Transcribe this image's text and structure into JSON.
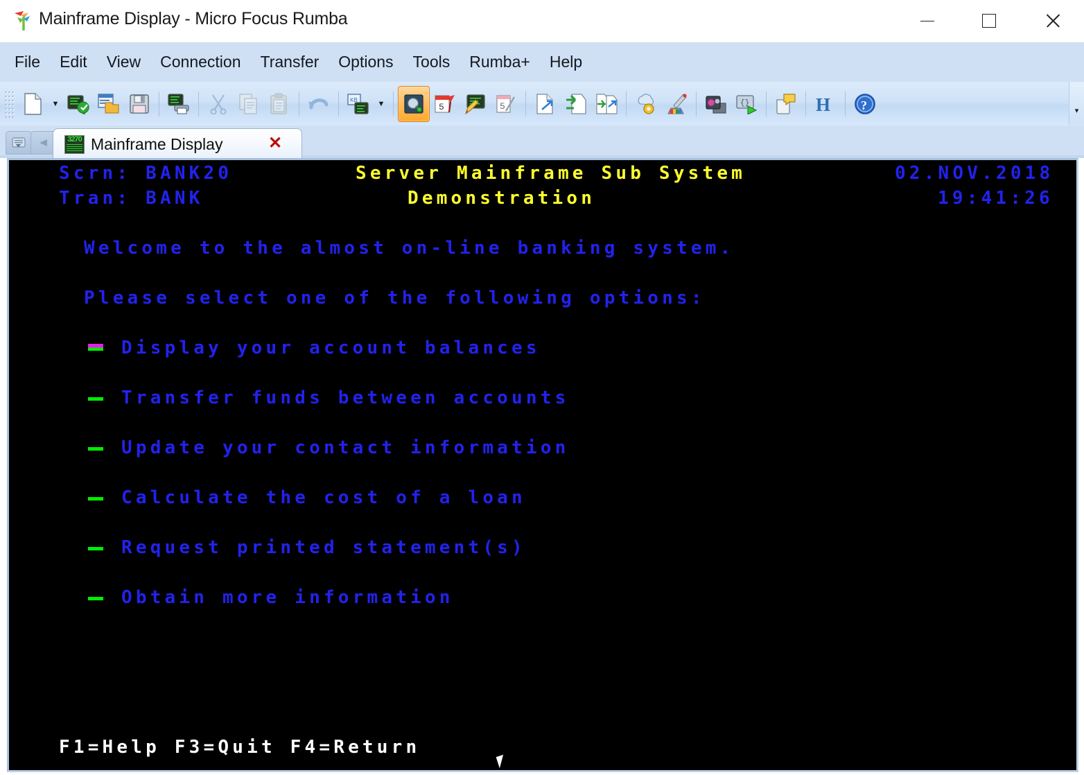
{
  "window": {
    "title": "Mainframe Display - Micro Focus Rumba",
    "logo_icon": "rumba-bird-logo-icon",
    "minimize_label": "–",
    "maximize_label": "□",
    "close_label": "×"
  },
  "menubar": {
    "items": [
      {
        "label": "File"
      },
      {
        "label": "Edit"
      },
      {
        "label": "View"
      },
      {
        "label": "Connection"
      },
      {
        "label": "Transfer"
      },
      {
        "label": "Options"
      },
      {
        "label": "Tools"
      },
      {
        "label": "Rumba+"
      },
      {
        "label": "Help"
      }
    ]
  },
  "toolbar": {
    "overflow_label": "▾",
    "buttons": [
      {
        "name": "new-document-icon",
        "group": 1,
        "state": "enabled",
        "caret": true
      },
      {
        "name": "open-session-icon",
        "group": 1,
        "state": "enabled",
        "caret": false
      },
      {
        "name": "open-folder-window-icon",
        "group": 1,
        "state": "enabled",
        "caret": false
      },
      {
        "name": "save-icon",
        "group": 1,
        "state": "enabled",
        "caret": false
      },
      {
        "name": "print-screen-icon",
        "group": 2,
        "state": "enabled",
        "caret": false
      },
      {
        "name": "cut-scissors-icon",
        "group": 3,
        "state": "disabled",
        "caret": false
      },
      {
        "name": "copy-icon",
        "group": 3,
        "state": "disabled",
        "caret": false
      },
      {
        "name": "paste-icon",
        "group": 3,
        "state": "disabled",
        "caret": false
      },
      {
        "name": "undo-icon",
        "group": 4,
        "state": "enabled",
        "caret": false
      },
      {
        "name": "keyboard-remap-icon",
        "group": 5,
        "state": "enabled",
        "caret": true
      },
      {
        "name": "hotspots-icon",
        "group": 6,
        "state": "active",
        "caret": false
      },
      {
        "name": "calendar-pin-icon",
        "group": 6,
        "state": "enabled",
        "caret": false
      },
      {
        "name": "edit-screen-icon",
        "group": 6,
        "state": "enabled",
        "caret": false
      },
      {
        "name": "calendar-edit-icon",
        "group": 6,
        "state": "enabled",
        "caret": false
      },
      {
        "name": "send-file-icon",
        "group": 7,
        "state": "enabled",
        "caret": false
      },
      {
        "name": "receive-file-icon",
        "group": 7,
        "state": "enabled",
        "caret": false
      },
      {
        "name": "transfer-files-icon",
        "group": 7,
        "state": "enabled",
        "caret": false
      },
      {
        "name": "settings-gear-cloud-icon",
        "group": 8,
        "state": "enabled",
        "caret": false
      },
      {
        "name": "color-brush-icon",
        "group": 8,
        "state": "enabled",
        "caret": false
      },
      {
        "name": "record-macro-icon",
        "group": 9,
        "state": "enabled",
        "caret": false
      },
      {
        "name": "play-macro-icon",
        "group": 9,
        "state": "enabled",
        "caret": false
      },
      {
        "name": "notes-icon",
        "group": 10,
        "state": "enabled",
        "caret": false
      },
      {
        "name": "hllapi-icon",
        "group": 11,
        "state": "enabled",
        "caret": false
      },
      {
        "name": "help-icon",
        "group": 12,
        "state": "enabled",
        "caret": false
      }
    ]
  },
  "tabstrip": {
    "left_buttons": [
      {
        "name": "tab-list-button"
      },
      {
        "name": "tab-nav-button"
      }
    ],
    "active_tab": {
      "icon": "3270-session-icon",
      "icon_text": "3270",
      "label": "Mainframe Display",
      "close_label": "✕"
    },
    "right_button": {
      "name": "tab-overflow-button"
    }
  },
  "terminal": {
    "header": {
      "screen_label": "Scrn: BANK20",
      "tran_label": "Tran: BANK",
      "title_line1": "Server Mainframe Sub System",
      "title_line2": "Demonstration",
      "date": "02.NOV.2018",
      "time": "19:41:26"
    },
    "body": {
      "welcome": "Welcome to the almost on-line banking system.",
      "prompt": "Please select one of the following options:"
    },
    "options": [
      {
        "label": "Display your account balances",
        "marker": "cursor"
      },
      {
        "label": "Transfer funds between accounts",
        "marker": "field"
      },
      {
        "label": "Update your contact information",
        "marker": "field"
      },
      {
        "label": "Calculate the cost of a loan",
        "marker": "field"
      },
      {
        "label": "Request printed statement(s)",
        "marker": "field"
      },
      {
        "label": "Obtain more information",
        "marker": "field"
      }
    ],
    "status_line": "F1=Help F3=Quit F4=Return",
    "colors": {
      "background": "#000000",
      "blue_text": "#2222ee",
      "yellow_text": "#ffff2e",
      "white_text": "#ffffff",
      "green_field": "#00ee00",
      "cursor_magenta": "#e81ee8"
    }
  }
}
